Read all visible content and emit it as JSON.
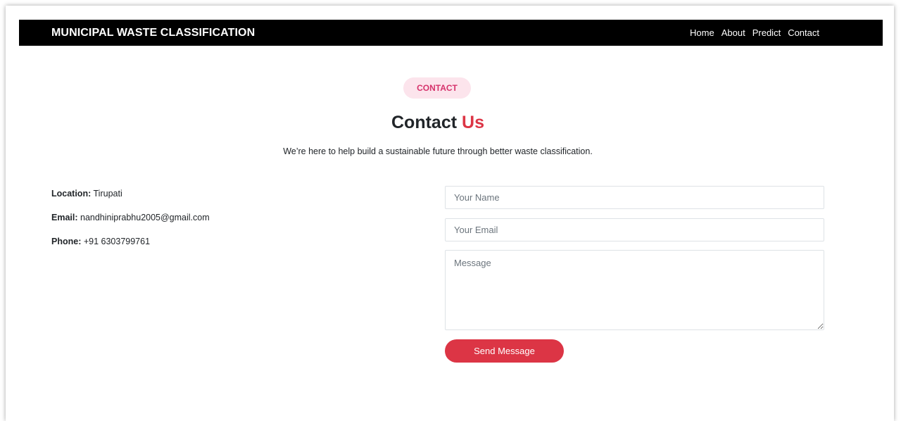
{
  "navbar": {
    "brand": "MUNICIPAL WASTE CLASSIFICATION",
    "links": [
      "Home",
      "About",
      "Predict",
      "Contact"
    ]
  },
  "section": {
    "badge": "CONTACT",
    "title_main": "Contact",
    "title_accent": "Us",
    "subtitle": "We’re here to help build a sustainable future through better waste classification."
  },
  "contact_info": {
    "location_label": "Location:",
    "location_value": "Tirupati",
    "email_label": "Email:",
    "email_value": "nandhiniprabhu2005@gmail.com",
    "phone_label": "Phone:",
    "phone_value": "+91 6303799761"
  },
  "form": {
    "name_placeholder": "Your Name",
    "email_placeholder": "Your Email",
    "message_placeholder": "Message",
    "submit_label": "Send Message"
  },
  "colors": {
    "navbar_bg": "#000000",
    "accent": "#dc3545",
    "badge_bg": "#fce4ec",
    "badge_text": "#d6336c"
  }
}
